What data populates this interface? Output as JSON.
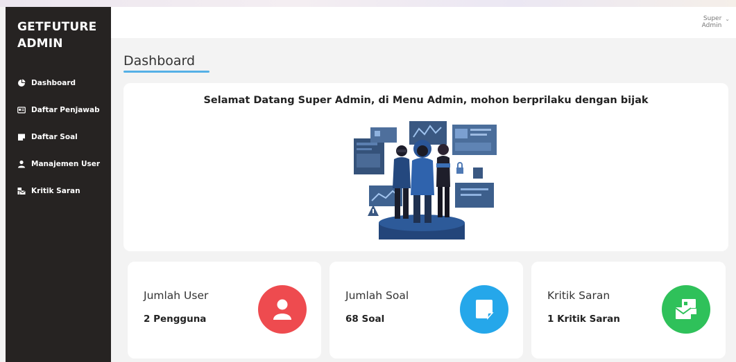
{
  "brand": {
    "line1": "GETFUTURE",
    "line2": "ADMIN"
  },
  "sidebar": {
    "items": [
      {
        "label": "Dashboard",
        "icon": "pie-chart-icon"
      },
      {
        "label": "Daftar Penjawab",
        "icon": "id-card-icon"
      },
      {
        "label": "Daftar Soal",
        "icon": "sticky-note-icon"
      },
      {
        "label": "Manajemen User",
        "icon": "user-icon"
      },
      {
        "label": "Kritik Saran",
        "icon": "mail-bulk-icon"
      }
    ]
  },
  "topbar": {
    "user_line1": "Super",
    "user_line2": "Admin",
    "caret_icon": "chevron-down-icon"
  },
  "page": {
    "title": "Dashboard"
  },
  "welcome": {
    "message": "Selamat Datang Super Admin, di Menu Admin, mohon berprilaku dengan bijak",
    "illustration": "hacker-team-illustration"
  },
  "stats": [
    {
      "label": "Jumlah User",
      "value": "2 Pengguna",
      "icon": "user-icon",
      "color": "#ee4b4f"
    },
    {
      "label": "Jumlah Soal",
      "value": "68 Soal",
      "icon": "sticky-note-icon",
      "color": "#25a7ea"
    },
    {
      "label": "Kritik Saran",
      "value": "1 Kritik Saran",
      "icon": "mail-bulk-icon",
      "color": "#2fc15a"
    }
  ],
  "colors": {
    "sidebar_bg": "#262322",
    "accent_underline": "#54b0e6",
    "page_bg": "#f3f3f3"
  }
}
